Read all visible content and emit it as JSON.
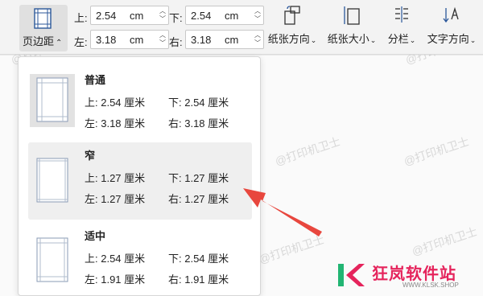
{
  "toolbar": {
    "margin_button_label": "页边距",
    "fields": {
      "top": {
        "label": "上:",
        "value": "2.54",
        "unit": "cm"
      },
      "bottom": {
        "label": "下:",
        "value": "2.54",
        "unit": "cm"
      },
      "left": {
        "label": "左:",
        "value": "3.18",
        "unit": "cm"
      },
      "right": {
        "label": "右:",
        "value": "3.18",
        "unit": "cm"
      }
    },
    "orientation_label": "纸张方向",
    "size_label": "纸张大小",
    "columns_label": "分栏",
    "text_direction_label": "文字方向"
  },
  "presets": [
    {
      "name": "普通",
      "top": "上: 2.54 厘米",
      "bottom": "下: 2.54 厘米",
      "left": "左: 3.18 厘米",
      "right": "右: 3.18 厘米",
      "selected": true
    },
    {
      "name": "窄",
      "top": "上: 1.27 厘米",
      "bottom": "下: 1.27 厘米",
      "left": "左: 1.27 厘米",
      "right": "右: 1.27 厘米",
      "highlighted": true
    },
    {
      "name": "适中",
      "top": "上: 2.54 厘米",
      "bottom": "下: 2.54 厘米",
      "left": "左: 1.91 厘米",
      "right": "右: 1.91 厘米"
    }
  ],
  "watermark": "@打印机卫士",
  "brand": {
    "name": "狂岚软件站",
    "url": "WWW.KLSK.SHOP",
    "color": "#e5245c"
  },
  "icons": {
    "margin": "page-margin-icon",
    "orientation": "page-orientation-icon",
    "size": "paper-size-icon",
    "columns": "columns-icon",
    "text_direction": "text-direction-icon",
    "arrow": "red-arrow"
  }
}
